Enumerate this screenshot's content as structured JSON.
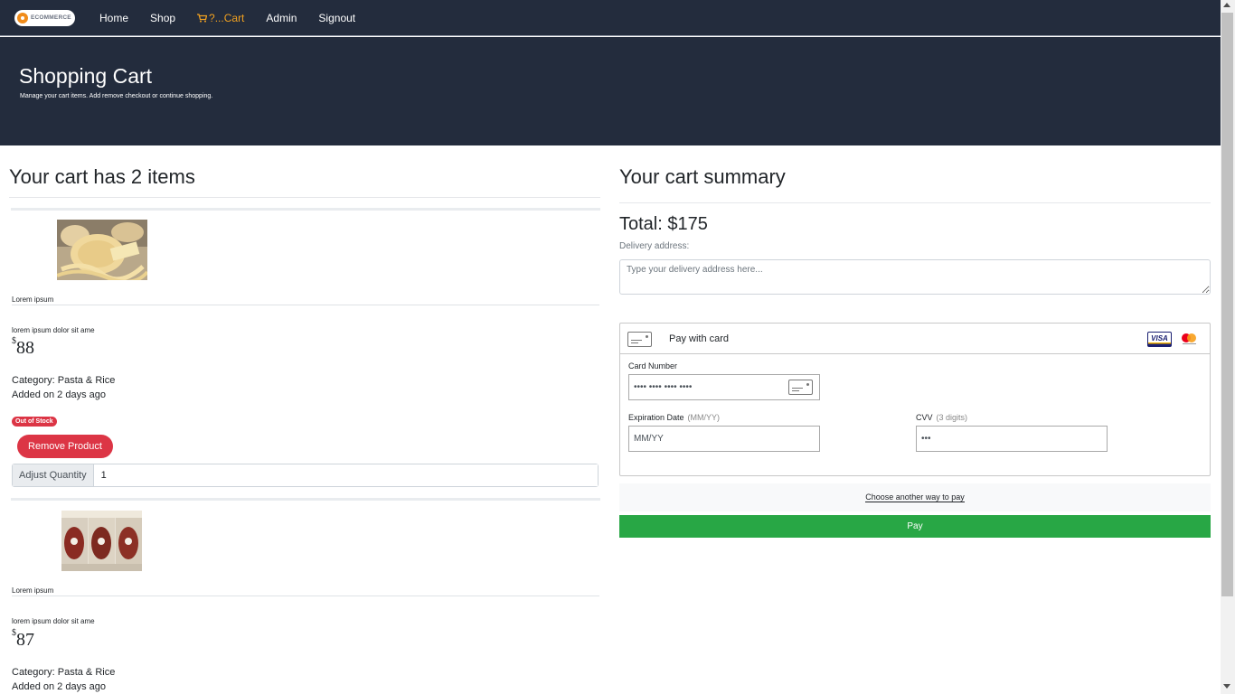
{
  "nav": {
    "logo_text": "ECOMMERCE",
    "links": [
      "Home",
      "Shop",
      "?...Cart",
      "Admin",
      "Signout"
    ],
    "accent": "#f0a020",
    "bg": "#232c3d"
  },
  "hero": {
    "title": "Shopping Cart",
    "subtitle": "Manage your cart items. Add remove checkout or continue shopping."
  },
  "cart": {
    "heading": "Your cart has 2 items",
    "items": [
      {
        "name": "Lorem ipsum",
        "description": "lorem ipsum dolor sit ame",
        "currency": "$",
        "price": "88",
        "category": "Category: Pasta & Rice",
        "added": "Added on 2 days ago",
        "badge": "Out of Stock",
        "remove_label": "Remove Product",
        "qty_label": "Adjust Quantity",
        "qty_value": "1"
      },
      {
        "name": "Lorem ipsum",
        "description": "lorem ipsum dolor sit ame",
        "currency": "$",
        "price": "87",
        "category": "Category: Pasta & Rice",
        "added": "Added on 2 days ago"
      }
    ]
  },
  "summary": {
    "heading": "Your cart summary",
    "total": "Total: $175",
    "delivery_label": "Delivery address:",
    "delivery_placeholder": "Type your delivery address here...",
    "pay_with_card": "Pay with card",
    "visa_text": "VISA",
    "card_number_label": "Card Number",
    "card_number_value": "•••• •••• •••• ••••",
    "expiration_label": "Expiration Date",
    "expiration_hint": "(MM/YY)",
    "expiration_value": "MM/YY",
    "cvv_label": "CVV",
    "cvv_hint": "(3 digits)",
    "cvv_value": "•••",
    "alt_pay": "Choose another way to pay",
    "pay_button": "Pay",
    "pay_color": "#28a745",
    "danger_color": "#dc3545"
  }
}
